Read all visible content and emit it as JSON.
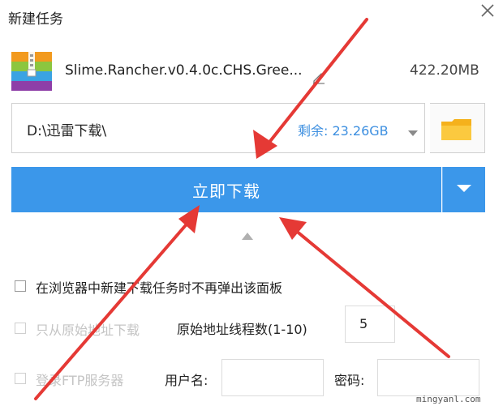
{
  "dialog": {
    "title": "新建任务"
  },
  "file": {
    "name": "Slime.Rancher.v0.4.0c.CHS.Gree...",
    "size": "422.20MB",
    "icon": "zip-archive-icon"
  },
  "path": {
    "value": "D:\\迅雷下载\\",
    "free_space": "剩余: 23.26GB"
  },
  "actions": {
    "download_now": "立即下载"
  },
  "options": {
    "no_popup_label": "在浏览器中新建下载任务时不再弹出该面板",
    "origin_only_label": "只从原始地址下载",
    "thread_count_label": "原始地址线程数(1-10)",
    "thread_count_value": "5",
    "ftp_login_label": "登录FTP服务器",
    "username_label": "用户名:",
    "password_label": "密码:"
  },
  "watermark": "mingyanl.com",
  "colors": {
    "primary": "#3b97ea",
    "free_space_text": "#3d8fe0",
    "annotation_arrow": "#e53935",
    "folder": "#f5b11c"
  }
}
